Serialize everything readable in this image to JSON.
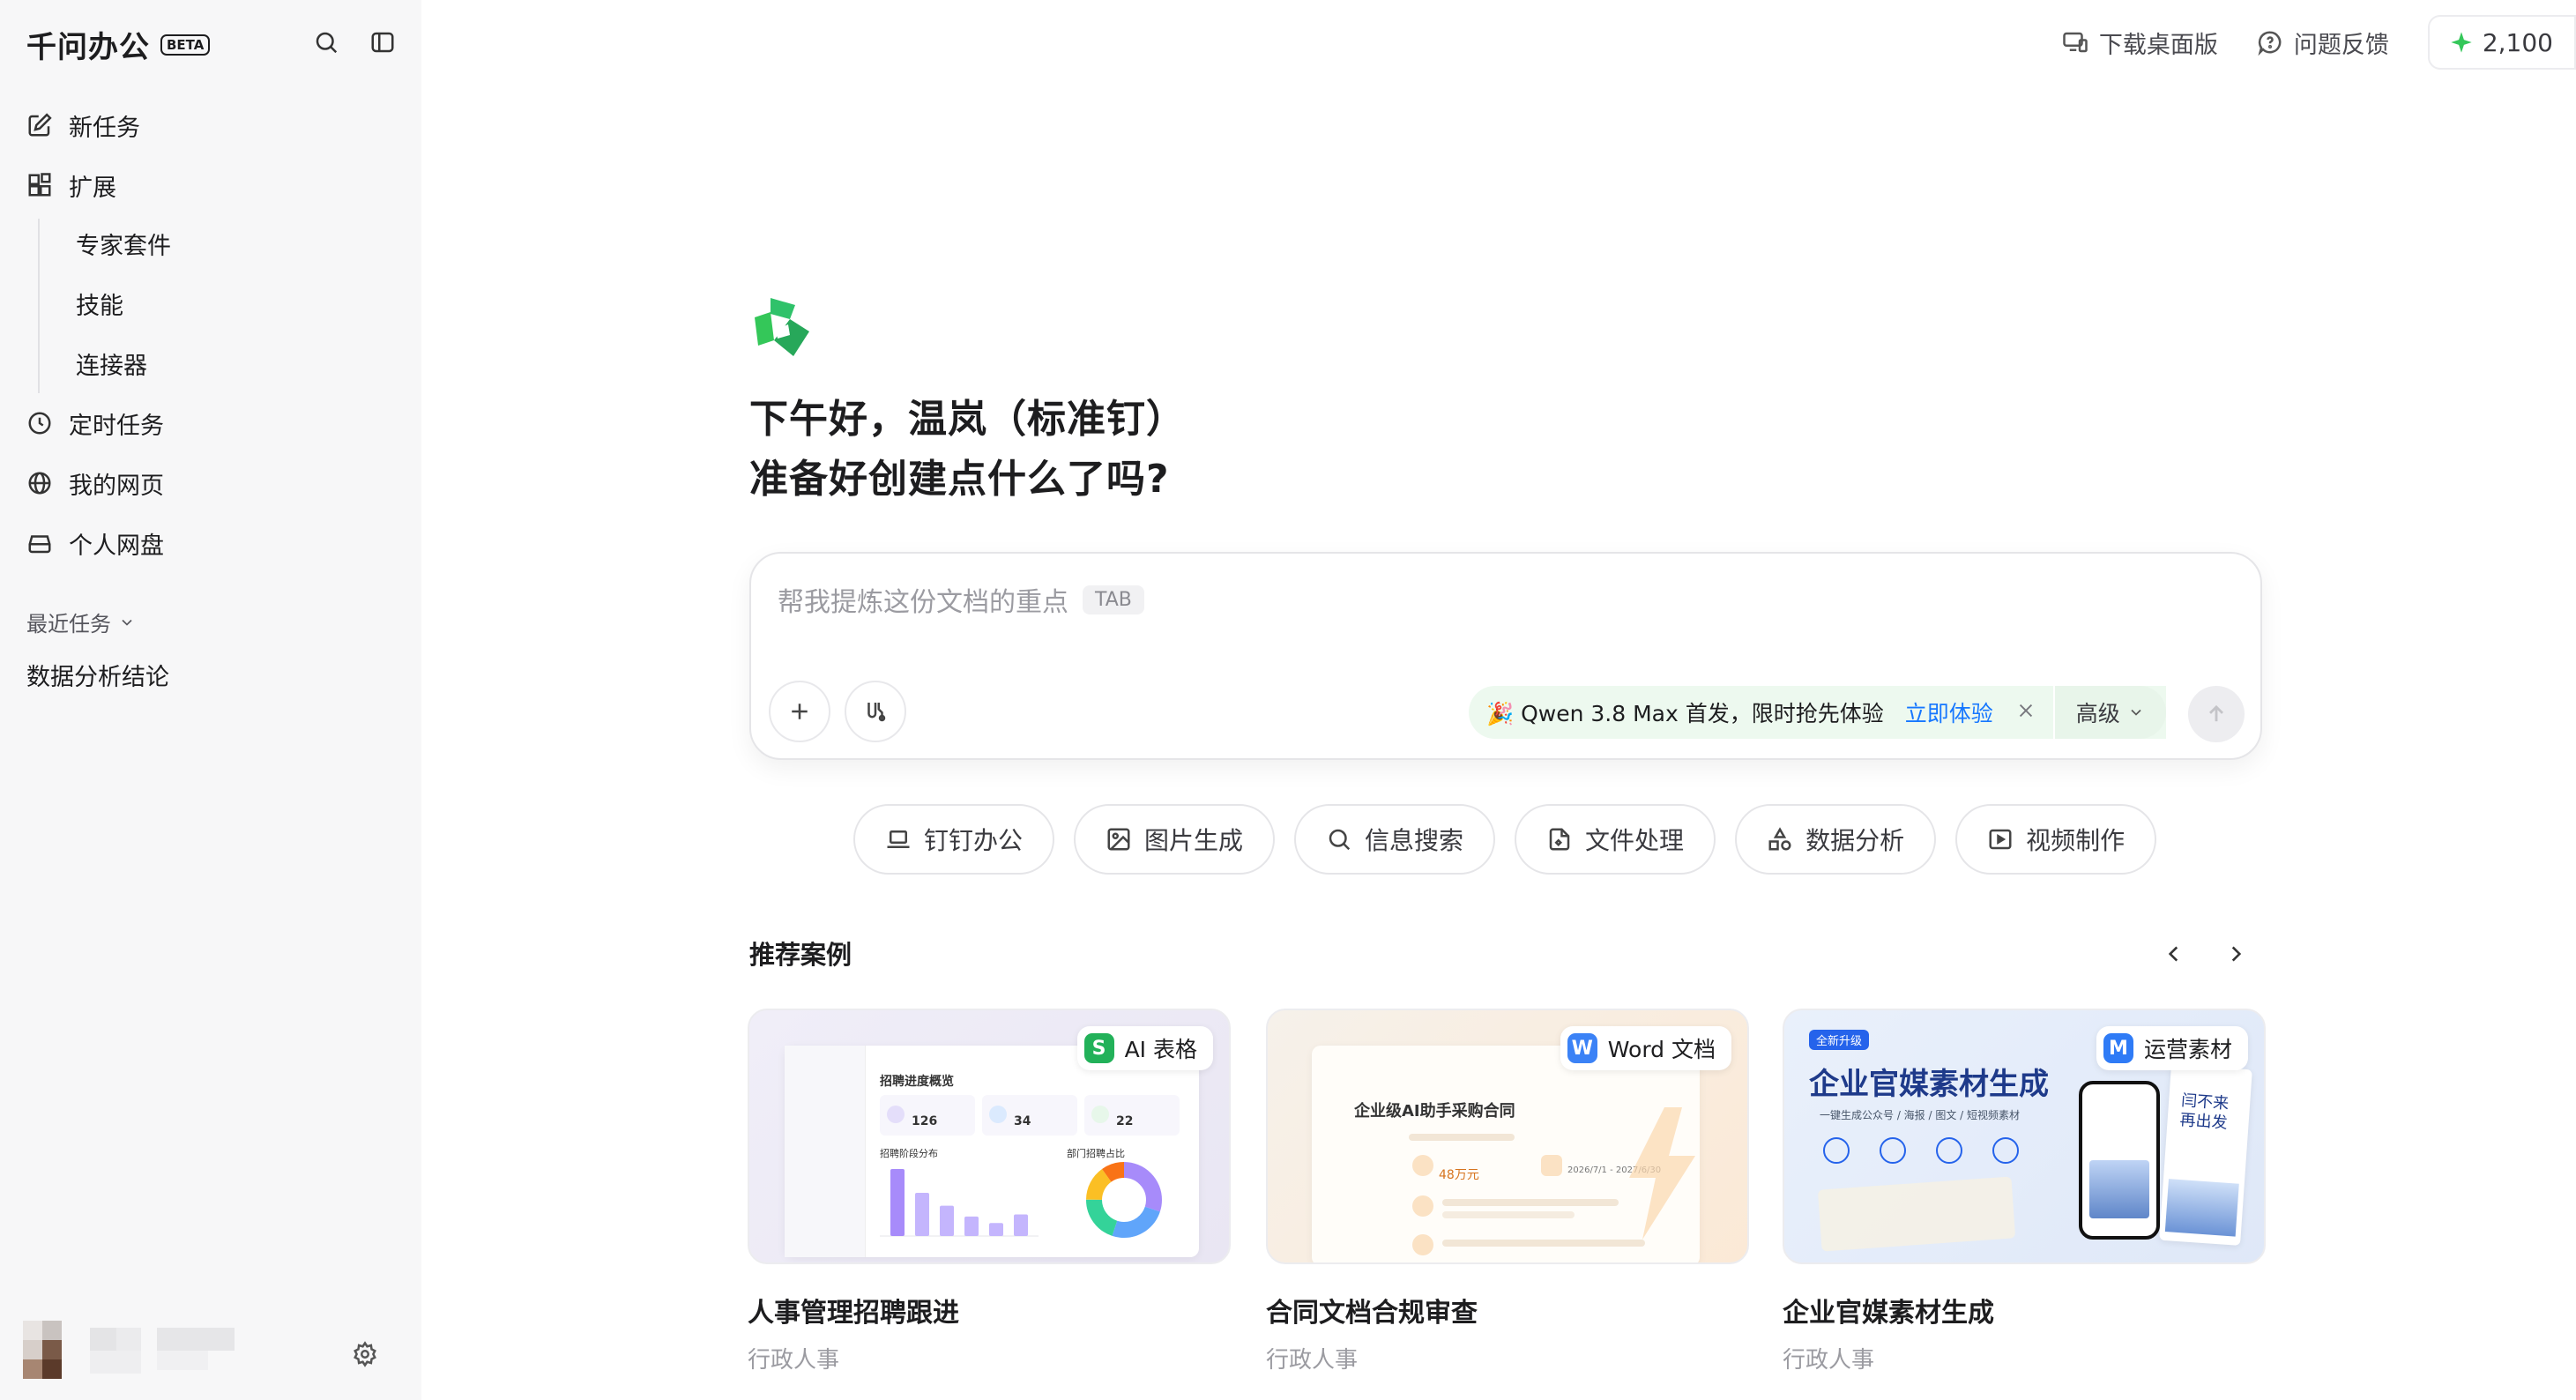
{
  "app": {
    "name": "千问办公",
    "beta": "BETA"
  },
  "sidebar": {
    "items": [
      {
        "label": "新任务",
        "icon": "edit-icon"
      },
      {
        "label": "扩展",
        "icon": "extension-icon"
      },
      {
        "label": "定时任务",
        "icon": "clock-icon"
      },
      {
        "label": "我的网页",
        "icon": "globe-icon"
      },
      {
        "label": "个人网盘",
        "icon": "drive-icon"
      }
    ],
    "sub_items": [
      "专家套件",
      "技能",
      "连接器"
    ],
    "recent_label": "最近任务",
    "recent_items": [
      "数据分析结论"
    ]
  },
  "header": {
    "download": "下载桌面版",
    "feedback": "问题反馈",
    "points": "2,100"
  },
  "main": {
    "greeting_line1": "下午好，温岚（标准钉）",
    "greeting_line2": "准备好创建点什么了吗?",
    "input": {
      "placeholder": "帮我提炼这份文档的重点",
      "tab_hint": "TAB"
    },
    "promo": {
      "text": "🎉 Qwen 3.8 Max 首发，限时抢先体验",
      "cta": "立即体验",
      "mode": "高级"
    },
    "chips": [
      {
        "label": "钉钉办公",
        "icon": "laptop-icon"
      },
      {
        "label": "图片生成",
        "icon": "image-icon"
      },
      {
        "label": "信息搜索",
        "icon": "search-icon"
      },
      {
        "label": "文件处理",
        "icon": "file-icon"
      },
      {
        "label": "数据分析",
        "icon": "shapes-icon"
      },
      {
        "label": "视频制作",
        "icon": "video-icon"
      }
    ],
    "recommend_title": "推荐案例",
    "cards": [
      {
        "title": "人事管理招聘跟进",
        "category": "行政人事",
        "badge": "AI 表格",
        "preview": {
          "heading": "招聘进度概览",
          "stats": [
            "126",
            "34",
            "22"
          ],
          "left_chart": "招聘阶段分布",
          "right_chart": "部门招聘占比",
          "bar_values": [
            62,
            40,
            28,
            18,
            12,
            20
          ],
          "donut": [
            0.3,
            0.25,
            0.2,
            0.15,
            0.1
          ]
        }
      },
      {
        "title": "合同文档合规审查",
        "category": "行政人事",
        "badge": "Word 文档",
        "preview": {
          "heading": "企业级AI助手采购合同",
          "amount": "48万元",
          "dates": "2026/7/1 - 2027/6/30"
        }
      },
      {
        "title": "企业官媒素材生成",
        "category": "行政人事",
        "badge": "运营素材",
        "preview": {
          "tag": "全新升级",
          "heading": "企业官媒素材生成",
          "sub": "一键生成公众号 / 海报 / 图文 / 短视频素材",
          "phone_text": "闫不来 再出发"
        }
      }
    ]
  },
  "colors": {
    "accent_green": "#34c759",
    "link_blue": "#1677ff",
    "sidebar_bg": "#f7f7f8",
    "promo_bg": "#edf9ef"
  }
}
